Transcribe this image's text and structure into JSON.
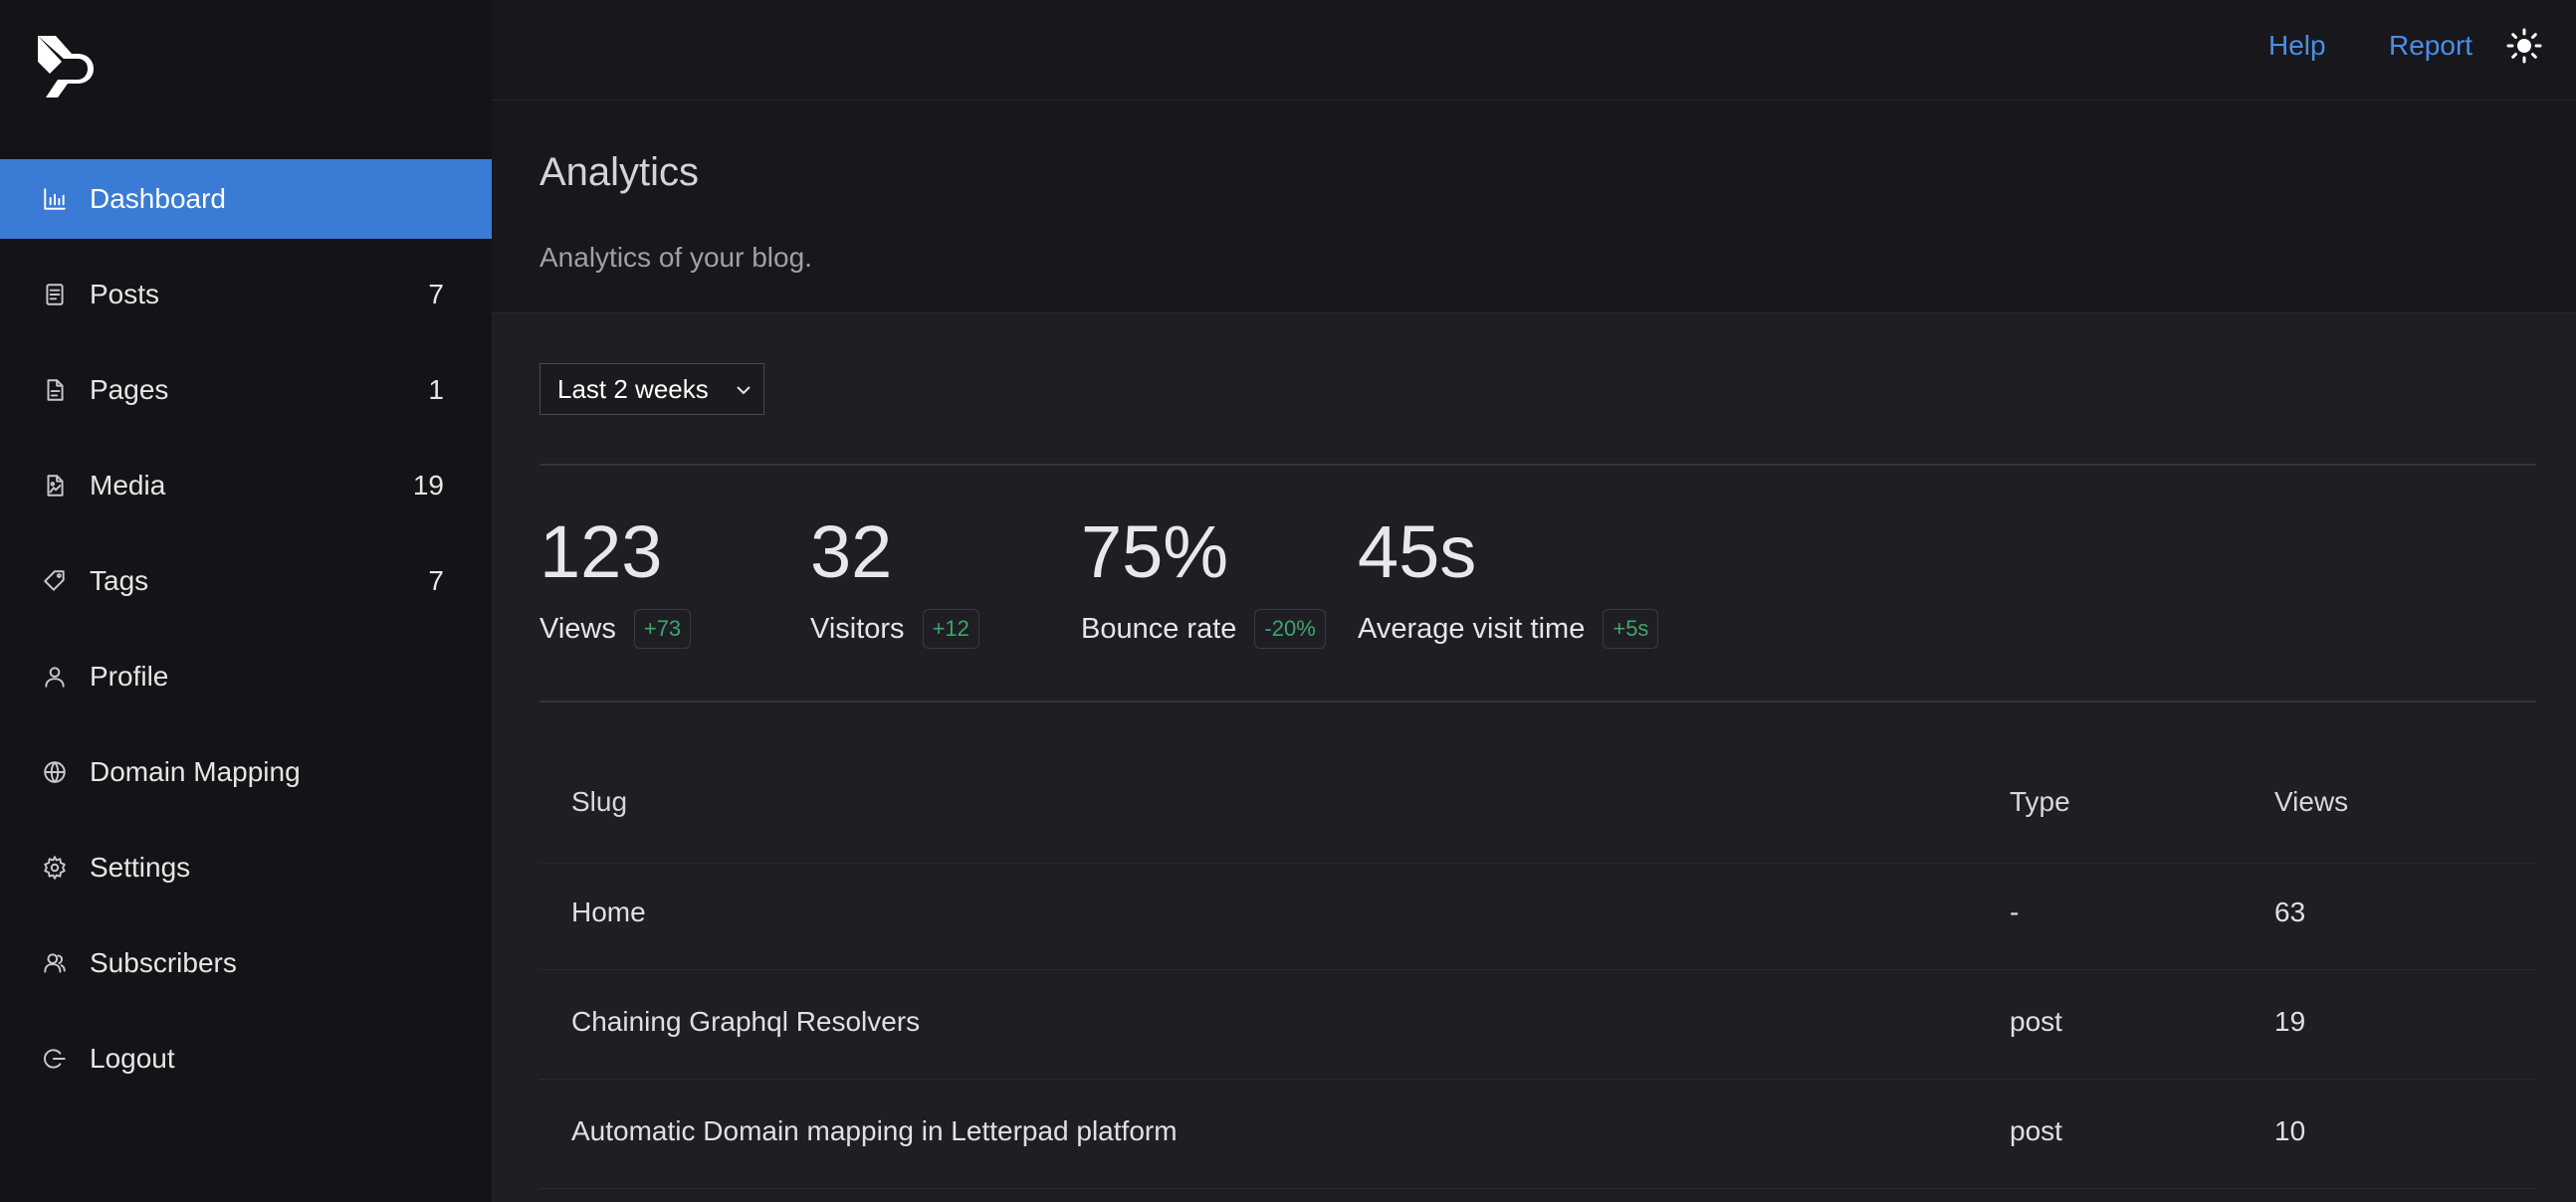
{
  "topbar": {
    "help_label": "Help",
    "report_label": "Report",
    "theme_icon": "sun-icon"
  },
  "sidebar": {
    "logo": "letterpad-logo",
    "items": [
      {
        "label": "Dashboard",
        "icon": "chart-icon",
        "count": "",
        "active": true
      },
      {
        "label": "Posts",
        "icon": "posts-icon",
        "count": "7"
      },
      {
        "label": "Pages",
        "icon": "page-icon",
        "count": "1"
      },
      {
        "label": "Media",
        "icon": "media-icon",
        "count": "19"
      },
      {
        "label": "Tags",
        "icon": "tag-icon",
        "count": "7"
      },
      {
        "label": "Profile",
        "icon": "user-icon",
        "count": ""
      },
      {
        "label": "Domain Mapping",
        "icon": "globe-icon",
        "count": ""
      },
      {
        "label": "Settings",
        "icon": "gear-icon",
        "count": ""
      },
      {
        "label": "Subscribers",
        "icon": "subscribers-icon",
        "count": ""
      },
      {
        "label": "Logout",
        "icon": "logout-icon",
        "count": ""
      }
    ]
  },
  "header": {
    "title": "Analytics",
    "subtitle": "Analytics of your blog."
  },
  "filter": {
    "selected": "Last 2 weeks"
  },
  "stats": [
    {
      "value": "123",
      "label": "Views",
      "change": "+73"
    },
    {
      "value": "32",
      "label": "Visitors",
      "change": "+12"
    },
    {
      "value": "75%",
      "label": "Bounce rate",
      "change": "-20%"
    },
    {
      "value": "45s",
      "label": "Average visit time",
      "change": "+5s"
    }
  ],
  "table": {
    "headers": [
      "Slug",
      "Type",
      "Views"
    ],
    "rows": [
      [
        "Home",
        "-",
        "63"
      ],
      [
        "Chaining Graphql Resolvers",
        "post",
        "19"
      ],
      [
        "Automatic Domain mapping in Letterpad platform",
        "post",
        "10"
      ]
    ]
  },
  "colors": {
    "accent": "#3a7bd5",
    "link": "#4a8fe7",
    "positive": "#3fa66a",
    "sidebar_bg": "#141418",
    "page_bg": "#1e1e24"
  }
}
